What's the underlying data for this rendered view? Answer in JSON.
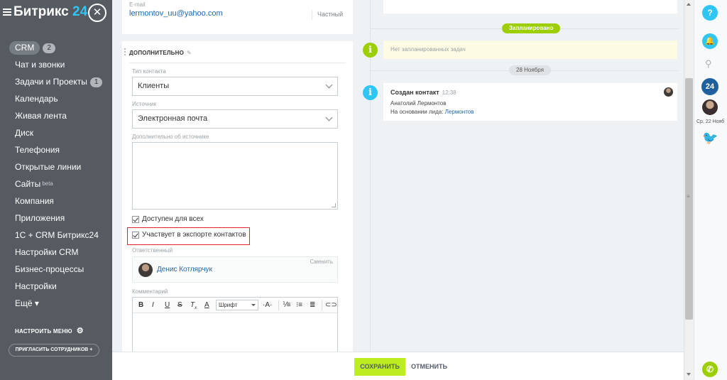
{
  "sidebar": {
    "logo_text": "Битрикс",
    "logo_num": "24",
    "close_symbol": "✕",
    "menu": [
      {
        "label": "CRM",
        "counter": "2"
      },
      {
        "label": "Чат и звонки"
      },
      {
        "label": "Задачи и Проекты",
        "counter": "1"
      },
      {
        "label": "Календарь"
      },
      {
        "label": "Живая лента"
      },
      {
        "label": "Диск"
      },
      {
        "label": "Телефония"
      },
      {
        "label": "Открытые линии"
      },
      {
        "label": "Сайты",
        "badge": "beta"
      },
      {
        "label": "Компания"
      },
      {
        "label": "Приложения"
      },
      {
        "label": "1С + CRM Битрикс24"
      },
      {
        "label": "Настройки CRM"
      },
      {
        "label": "Бизнес-процессы"
      },
      {
        "label": "Настройки"
      },
      {
        "label": "Ещё ▾"
      }
    ],
    "setup_menu": "НАСТРОИТЬ МЕНЮ",
    "invite": "ПРИГЛАСИТЬ СОТРУДНИКОВ  +"
  },
  "email_card": {
    "label": "E-mail",
    "value": "lermontov_uu@yahoo.com",
    "type": "Частный"
  },
  "extra_section": {
    "title": "ДОПОЛНИТЕЛЬНО",
    "contact_type_label": "Тип контакта",
    "contact_type_value": "Клиенты",
    "source_label": "Источник",
    "source_value": "Электронная почта",
    "source_extra_label": "Дополнительно об источнике",
    "checkbox_available": "Доступен для всех",
    "checkbox_export": "Участвует в экспорте контактов",
    "responsible_label": "Ответственный",
    "responsible_name": "Денис Котлярчук",
    "responsible_change": "Сменить",
    "comment_label": "Комментарий",
    "editor_font": "Шрифт"
  },
  "timeline": {
    "planned_badge": "Запланировано",
    "no_tasks": "Нет запланированных задач",
    "date_badge": "28 Ноября",
    "created_title": "Создан контакт",
    "created_time": "12:38",
    "created_name": "Анатолий Лермонтов",
    "created_basis_prefix": "На основании лида:",
    "created_basis_link": "Лермонтов"
  },
  "rightbar": {
    "help": "?",
    "b24": "24",
    "date_label": "Ср, 22 Нояб"
  },
  "bottom": {
    "save": "СОХРАНИТЬ",
    "cancel": "ОТМЕНИТЬ"
  },
  "colors": {
    "sidebar_bg": "#555b60",
    "accent_blue": "#2fc6f6",
    "accent_green": "#9dcf00",
    "save_green": "#bbed21",
    "highlight_red": "#e0242b",
    "link_blue": "#2067b0"
  },
  "icons": {
    "menu": "hamburger-icon",
    "close": "close-icon",
    "settings": "gear-icon",
    "edit": "pencil-icon",
    "dropdown": "chevron-down-icon",
    "info": "info-icon",
    "help": "question-icon",
    "notifications": "bell-icon",
    "search": "search-icon",
    "bitrix24": "bitrix24-icon",
    "chat": "bird-icon",
    "phone": "phone-icon"
  }
}
